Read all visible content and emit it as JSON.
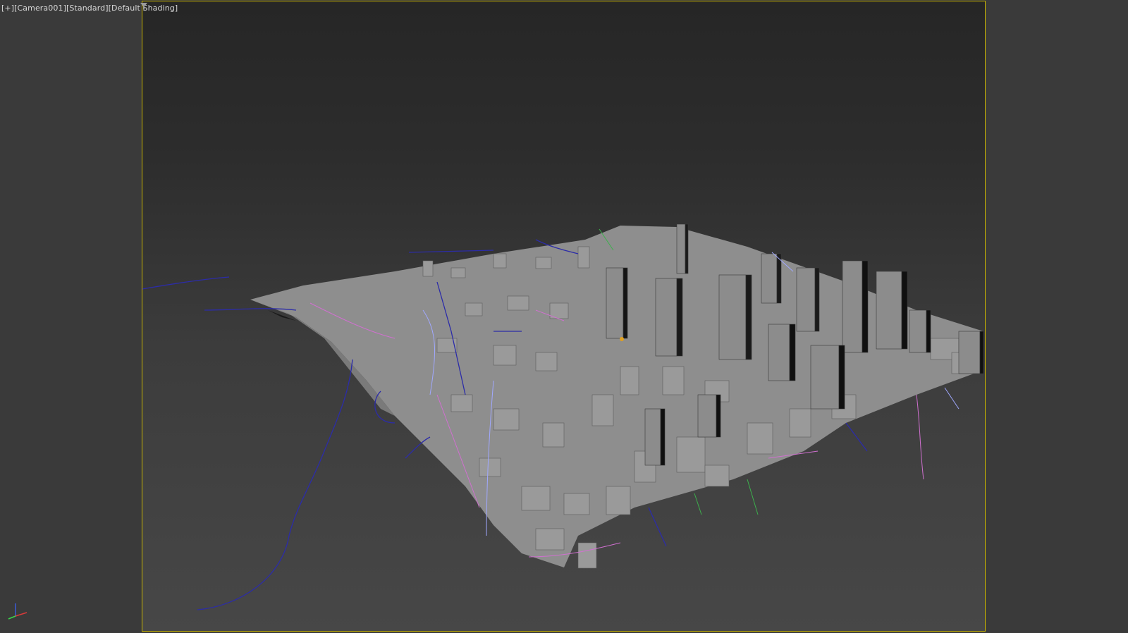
{
  "viewport": {
    "menu_plus": "[+]",
    "camera": "[Camera001]",
    "view_mode": "[Standard]",
    "shading": "[Default Shading]"
  },
  "icons": {
    "filter": "funnel-icon",
    "axis": "axis-tripod-icon"
  },
  "colors": {
    "background": "#3a3a3a",
    "safe_frame_border": "#c8b400",
    "geometry": "#8e8e8e",
    "spline_blue": "#2c2ca8",
    "spline_pink": "#d070d0",
    "spline_green": "#3cb04c",
    "spline_lightblue": "#a0a8ff"
  }
}
